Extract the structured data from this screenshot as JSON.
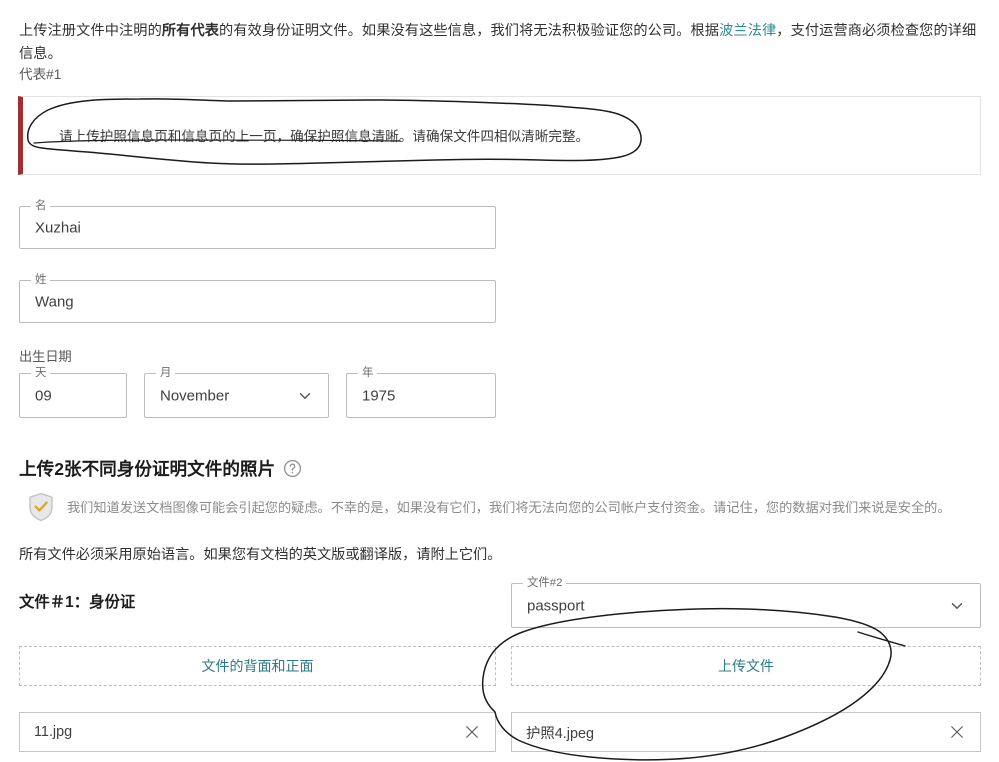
{
  "intro": {
    "part1": "上传注册文件中注明的",
    "bold": "所有代表",
    "part2": "的有效身份证明文件。如果没有这些信息，我们将无法积极验证您的公司。根据",
    "link": "波兰法律",
    "part3": "，支付运营商必须检查您的详细信息。"
  },
  "representative": {
    "label": "代表#1"
  },
  "alert": {
    "text": "请上传护照信息页和信息页的上一页，确保护照信息清晰。请确保文件四相似清晰完整。",
    "accent_color": "#a32e2e"
  },
  "form": {
    "first_name": {
      "label": "名",
      "value": "Xuzhai"
    },
    "last_name": {
      "label": "姓",
      "value": "Wang"
    },
    "dob": {
      "label": "出生日期",
      "day": {
        "label": "天",
        "value": "09"
      },
      "month": {
        "label": "月",
        "value": "November",
        "icon": "chevron-down-icon"
      },
      "year": {
        "label": "年",
        "value": "1975"
      }
    }
  },
  "upload_section": {
    "heading": "上传2张不同身份证明文件的照片",
    "help_icon": "question-circle-icon",
    "security": {
      "icon": "shield-check-icon",
      "text": "我们知道发送文档图像可能会引起您的疑虑。不幸的是，如果没有它们，我们将无法向您的公司帐户支付资金。请记住，您的数据对我们来说是安全的。"
    },
    "original_language_note": "所有文件必须采用原始语言。如果您有文档的英文版或翻译版，请附上它们。",
    "file1": {
      "heading": "文件＃1：身份证",
      "dropzone_label": "文件的背面和正面",
      "uploaded_file": "11.jpg",
      "remove_icon": "close-icon"
    },
    "file2": {
      "select_label": "文件#2",
      "select_value": "passport",
      "select_icon": "chevron-down-icon",
      "dropzone_label": "上传文件",
      "uploaded_file": "护照4.jpeg",
      "remove_icon": "close-icon"
    },
    "link_color": "#2d7b83"
  },
  "annotations": {
    "ellipse_alert": "hand-drawn-ellipse-around-alert-text",
    "ellipse_file2": "hand-drawn-ellipse-around-file2-upload"
  }
}
